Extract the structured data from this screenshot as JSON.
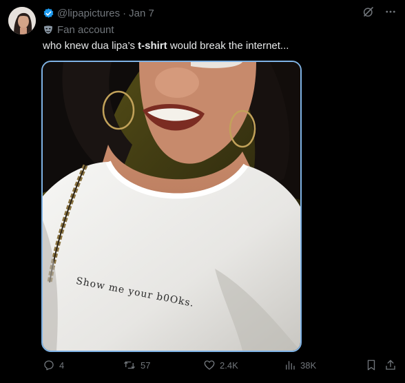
{
  "post": {
    "handle": "@lipapictures",
    "separator": "·",
    "date": "Jan 7",
    "account_label": "Fan account",
    "text_before": "who knew dua lipa’s ",
    "text_bold": "t-shirt",
    "text_after": " would break the internet..."
  },
  "media": {
    "shirt_print": "Show me your b0Oks."
  },
  "actions": {
    "replies": "4",
    "reposts": "57",
    "likes": "2.4K",
    "views": "38K"
  },
  "icons": {
    "verified": "verified-badge-icon",
    "fan": "mask-icon",
    "grok": "grok-icon",
    "more": "more-icon",
    "reply": "reply-icon",
    "repost": "repost-icon",
    "like": "heart-icon",
    "views": "views-icon",
    "bookmark": "bookmark-icon",
    "share": "share-icon"
  },
  "colors": {
    "background": "#000000",
    "text": "#e7e9ea",
    "muted": "#71767b",
    "verified": "#1d9bf0",
    "media_border": "#7fb3e6"
  }
}
